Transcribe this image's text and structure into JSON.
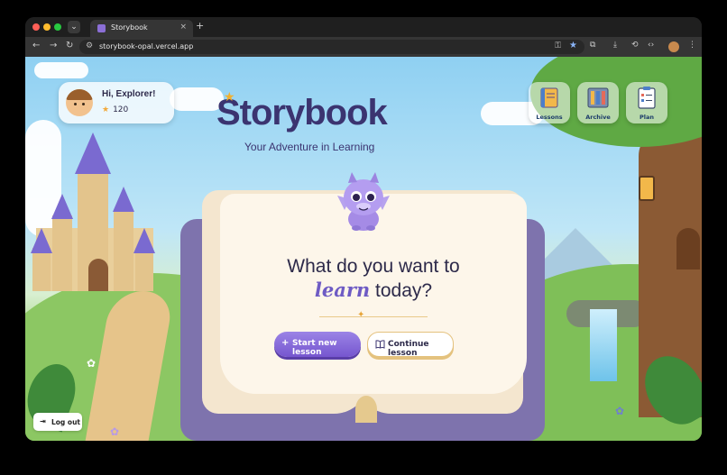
{
  "browser": {
    "tab_title": "Storybook",
    "tab_close": "×",
    "new_tab": "+",
    "url": "storybook-opal.vercel.app",
    "icons": [
      "back-icon",
      "forward-icon",
      "reload-icon",
      "site-settings-icon",
      "password-key-icon",
      "bookmark-star-icon",
      "extensions-icon",
      "download-icon",
      "history-icon",
      "devtools-icon",
      "profile-avatar",
      "more-menu-icon"
    ]
  },
  "user": {
    "greeting": "Hi, Explorer!",
    "points": "120"
  },
  "header": {
    "brand": "Storybook",
    "tagline": "Your Adventure in Learning"
  },
  "nav": {
    "lessons": "Lessons",
    "archive": "Archive",
    "plan": "Plan"
  },
  "book": {
    "question_line1": "What do you want to",
    "question_emphasis": "learn",
    "question_line2_rest": " today?",
    "start_label": "Start new lesson",
    "continue_label": "Continue lesson"
  },
  "footer": {
    "logout_label": "Log out"
  },
  "colors": {
    "brand": "#3b3470",
    "accent": "#7656cf",
    "gold": "#e4c27e"
  }
}
